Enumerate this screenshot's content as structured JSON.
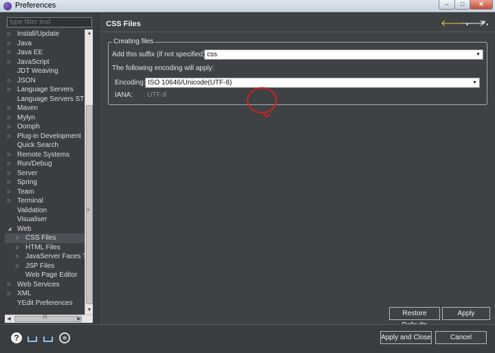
{
  "window": {
    "title": "Preferences",
    "min_glyph": "–",
    "max_glyph": "□",
    "close_glyph": "✕"
  },
  "filter": {
    "placeholder": "type filter text"
  },
  "tree": [
    {
      "label": "Install/Update",
      "level": 0,
      "twisty": "▷"
    },
    {
      "label": "Java",
      "level": 0,
      "twisty": "▷"
    },
    {
      "label": "Java EE",
      "level": 0,
      "twisty": "▷"
    },
    {
      "label": "JavaScript",
      "level": 0,
      "twisty": "▷"
    },
    {
      "label": "JDT Weaving",
      "level": 0,
      "twisty": ""
    },
    {
      "label": "JSON",
      "level": 0,
      "twisty": "▷"
    },
    {
      "label": "Language Servers",
      "level": 0,
      "twisty": "▷"
    },
    {
      "label": "Language Servers STS",
      "level": 0,
      "twisty": ""
    },
    {
      "label": "Maven",
      "level": 0,
      "twisty": "▷"
    },
    {
      "label": "Mylyn",
      "level": 0,
      "twisty": "▷"
    },
    {
      "label": "Oomph",
      "level": 0,
      "twisty": "▷"
    },
    {
      "label": "Plug-in Development",
      "level": 0,
      "twisty": "▷"
    },
    {
      "label": "Quick Search",
      "level": 0,
      "twisty": ""
    },
    {
      "label": "Remote Systems",
      "level": 0,
      "twisty": "▷"
    },
    {
      "label": "Run/Debug",
      "level": 0,
      "twisty": "▷"
    },
    {
      "label": "Server",
      "level": 0,
      "twisty": "▷"
    },
    {
      "label": "Spring",
      "level": 0,
      "twisty": "▷"
    },
    {
      "label": "Team",
      "level": 0,
      "twisty": "▷"
    },
    {
      "label": "Terminal",
      "level": 0,
      "twisty": "▷"
    },
    {
      "label": "Validation",
      "level": 0,
      "twisty": ""
    },
    {
      "label": "Visualiser",
      "level": 0,
      "twisty": ""
    },
    {
      "label": "Web",
      "level": 0,
      "twisty": "◢"
    },
    {
      "label": "CSS Files",
      "level": 1,
      "twisty": "▷",
      "selected": true
    },
    {
      "label": "HTML Files",
      "level": 1,
      "twisty": "▷"
    },
    {
      "label": "JavaServer Faces Tools",
      "level": 1,
      "twisty": "▷"
    },
    {
      "label": "JSP Files",
      "level": 1,
      "twisty": "▷"
    },
    {
      "label": "Web Page Editor",
      "level": 1,
      "twisty": ""
    },
    {
      "label": "Web Services",
      "level": 0,
      "twisty": "▷"
    },
    {
      "label": "XML",
      "level": 0,
      "twisty": "▷"
    },
    {
      "label": "YEdit Preferences",
      "level": 0,
      "twisty": ""
    }
  ],
  "scroll": {
    "up": "▲",
    "down": "▼",
    "left": "◀",
    "right": "▶",
    "grip_v": "≡",
    "grip_h": "III"
  },
  "page": {
    "title": "CSS Files",
    "nav_back": "🡐",
    "nav_fwd": "🡒",
    "nav_dd": "▾",
    "nav_menu": "▾",
    "group_title": "Creating files",
    "suffix_label": "Add this suffix (if not specified):",
    "suffix_value": "css",
    "encoding_note": "The following encoding will apply:",
    "encoding_label": "Encoding:",
    "encoding_value": "ISO 10646/Unicode(UTF-8)",
    "iana_label": "IANA:",
    "iana_value": "UTF-8",
    "caret": "▼",
    "restore_defaults": "Restore Defaults",
    "apply": "Apply"
  },
  "footer": {
    "help_glyph": "?",
    "apply_close": "Apply and Close",
    "cancel": "Cancel"
  }
}
